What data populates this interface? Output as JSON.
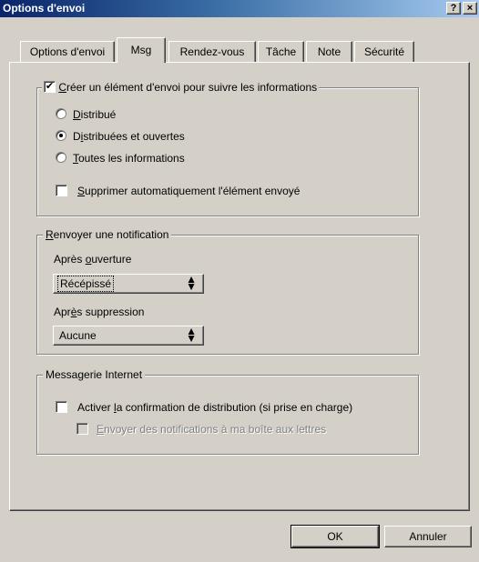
{
  "window": {
    "title": "Options d'envoi",
    "help_glyph": "?",
    "close_glyph": "×"
  },
  "tabs": [
    {
      "label": "Options d'envoi",
      "active": false
    },
    {
      "label": "Msg",
      "active": true
    },
    {
      "label": "Rendez-vous",
      "active": false
    },
    {
      "label": "Tâche",
      "active": false
    },
    {
      "label": "Note",
      "active": false
    },
    {
      "label": "Sécurité",
      "active": false
    }
  ],
  "tracking": {
    "checkbox_checked": true,
    "label_underline": "C",
    "label_rest": "réer un élément d'envoi pour suivre les informations",
    "options": [
      {
        "underline": "D",
        "rest": "istribué",
        "selected": false
      },
      {
        "pre": "D",
        "underline": "i",
        "rest": "stribuées et ouvertes",
        "selected": true
      },
      {
        "underline": "T",
        "rest": "outes les informations",
        "selected": false
      }
    ],
    "auto_delete": {
      "underline": "S",
      "rest": "upprimer automatiquement l'élément envoyé",
      "checked": false
    }
  },
  "notification": {
    "title_underline": "R",
    "title_rest": "envoyer une notification",
    "after_open_label_pre": "Après ",
    "after_open_label_underline": "o",
    "after_open_label_rest": "uverture",
    "after_open_value": "Récépissé",
    "after_delete_label_pre": "Apr",
    "after_delete_label_underline": "è",
    "after_delete_label_rest": "s suppression",
    "after_delete_value": "Aucune",
    "arrow_up": "▲",
    "arrow_down": "▼"
  },
  "internet": {
    "title": "Messagerie Internet",
    "confirm_pre": "Activer ",
    "confirm_underline": "l",
    "confirm_rest": "a confirmation de distribution (si prise en charge)",
    "confirm_checked": false,
    "send_underline": "E",
    "send_rest": "nvoyer des notifications à ma boîte aux lettres",
    "send_checked": false
  },
  "buttons": {
    "ok": "OK",
    "cancel": "Annuler"
  }
}
